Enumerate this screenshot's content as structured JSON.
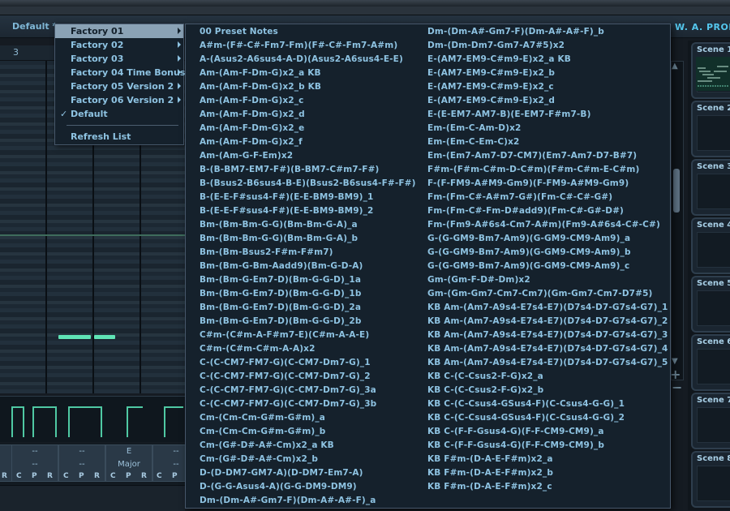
{
  "header": {
    "preset_name": "Default *",
    "brand": "W. A. PRODUCTION"
  },
  "timeline": {
    "bar_number": "3"
  },
  "chord_slots": [
    {
      "line1": "",
      "line2": ""
    },
    {
      "line1": "--",
      "line2": "--"
    },
    {
      "line1": "--",
      "line2": "--"
    },
    {
      "line1": "E",
      "line2": "Major"
    },
    {
      "line1": "--",
      "line2": "--"
    }
  ],
  "slot_letters": [
    "R",
    "C",
    "P",
    "R",
    "C",
    "P",
    "R",
    "C",
    "P",
    "R",
    "C",
    "P",
    "R",
    "C"
  ],
  "scenes": [
    "Scene 1",
    "Scene 2",
    "Scene 3",
    "Scene 4",
    "Scene 5",
    "Scene 6",
    "Scene 7",
    "Scene 8"
  ],
  "menu": {
    "items": [
      {
        "label": "Factory 01",
        "has_submenu": true,
        "highlighted": true
      },
      {
        "label": "Factory 02",
        "has_submenu": true
      },
      {
        "label": "Factory 03",
        "has_submenu": true
      },
      {
        "label": "Factory 04 Time Bonus",
        "has_submenu": true
      },
      {
        "label": "Factory 05 Version 2",
        "has_submenu": true
      },
      {
        "label": "Factory 06 Version 2",
        "has_submenu": true
      },
      {
        "label": "Default",
        "checked": true
      }
    ],
    "check_mark": "✓",
    "refresh_label": "Refresh List"
  },
  "presets": {
    "column1": [
      "00 Preset Notes",
      "A#m-(F#-C#-Fm7-Fm)(F#-C#-Fm7-A#m)",
      "A-(Asus2-A6sus4-A-D)(Asus2-A6sus4-E-E)",
      "Am-(Am-F-Dm-G)x2_a KB",
      "Am-(Am-F-Dm-G)x2_b KB",
      "Am-(Am-F-Dm-G)x2_c",
      "Am-(Am-F-Dm-G)x2_d",
      "Am-(Am-F-Dm-G)x2_e",
      "Am-(Am-F-Dm-G)x2_f",
      "Am-(Am-G-F-Em)x2",
      "B-(B-BM7-EM7-F#)(B-BM7-C#m7-F#)",
      "B-(Bsus2-B6sus4-B-E)(Bsus2-B6sus4-F#-F#)",
      "B-(E-E-F#sus4-F#)(E-E-BM9-BM9)_1",
      "B-(E-E-F#sus4-F#)(E-E-BM9-BM9)_2",
      "Bm-(Bm-Bm-G-G)(Bm-Bm-G-A)_a",
      "Bm-(Bm-Bm-G-G)(Bm-Bm-G-A)_b",
      "Bm-(Bm-Bsus2-F#m-F#m7)",
      "Bm-(Bm-G-Bm-Aadd9)(Bm-G-D-A)",
      "Bm-(Bm-G-Em7-D)(Bm-G-G-D)_1a",
      "Bm-(Bm-G-Em7-D)(Bm-G-G-D)_1b",
      "Bm-(Bm-G-Em7-D)(Bm-G-G-D)_2a",
      "Bm-(Bm-G-Em7-D)(Bm-G-G-D)_2b",
      "C#m-(C#m-A-F#m7-E)(C#m-A-A-E)",
      "C#m-(C#m-C#m-A-A)x2",
      "C-(C-CM7-FM7-G)(C-CM7-Dm7-G)_1",
      "C-(C-CM7-FM7-G)(C-CM7-Dm7-G)_2",
      "C-(C-CM7-FM7-G)(C-CM7-Dm7-G)_3a",
      "C-(C-CM7-FM7-G)(C-CM7-Dm7-G)_3b",
      "Cm-(Cm-Cm-G#m-G#m)_a",
      "Cm-(Cm-Cm-G#m-G#m)_b",
      "Cm-(G#-D#-A#-Cm)x2_a KB",
      "Cm-(G#-D#-A#-Cm)x2_b",
      "D-(D-DM7-GM7-A)(D-DM7-Em7-A)",
      "D-(G-G-Asus4-A)(G-G-DM9-DM9)",
      "Dm-(Dm-A#-Gm7-F)(Dm-A#-A#-F)_a"
    ],
    "column2": [
      "Dm-(Dm-A#-Gm7-F)(Dm-A#-A#-F)_b",
      "Dm-(Dm-Dm7-Gm7-A7#5)x2",
      "E-(AM7-EM9-C#m9-E)x2_a KB",
      "E-(AM7-EM9-C#m9-E)x2_b",
      "E-(AM7-EM9-C#m9-E)x2_c",
      "E-(AM7-EM9-C#m9-E)x2_d",
      "E-(E-EM7-AM7-B)(E-EM7-F#m7-B)",
      "Em-(Em-C-Am-D)x2",
      "Em-(Em-C-Em-C)x2",
      "Em-(Em7-Am7-D7-CM7)(Em7-Am7-D7-B#7)",
      "F#m-(F#m-C#m-D-C#m)(F#m-C#m-E-C#m)",
      "F-(F-FM9-A#M9-Gm9)(F-FM9-A#M9-Gm9)",
      "Fm-(Fm-C#-A#m7-G#)(Fm-C#-C#-G#)",
      "Fm-(Fm-C#-Fm-D#add9)(Fm-C#-G#-D#)",
      "Fm-(Fm9-A#6s4-Cm7-A#m)(Fm9-A#6s4-C#-C#)",
      "G-(G-GM9-Bm7-Am9)(G-GM9-CM9-Am9)_a",
      "G-(G-GM9-Bm7-Am9)(G-GM9-CM9-Am9)_b",
      "G-(G-GM9-Bm7-Am9)(G-GM9-CM9-Am9)_c",
      "Gm-(Gm-F-D#-Dm)x2",
      "Gm-(Gm-Gm7-Cm7-Cm7)(Gm-Gm7-Cm7-D7#5)",
      "KB Am-(Am7-A9s4-E7s4-E7)(D7s4-D7-G7s4-G7)_1",
      "KB Am-(Am7-A9s4-E7s4-E7)(D7s4-D7-G7s4-G7)_2",
      "KB Am-(Am7-A9s4-E7s4-E7)(D7s4-D7-G7s4-G7)_3",
      "KB Am-(Am7-A9s4-E7s4-E7)(D7s4-D7-G7s4-G7)_4",
      "KB Am-(Am7-A9s4-E7s4-E7)(D7s4-D7-G7s4-G7)_5",
      "KB C-(C-Csus2-F-G)x2_a",
      "KB C-(C-Csus2-F-G)x2_b",
      "KB C-(C-Csus4-GSus4-F)(C-Csus4-G-G)_1",
      "KB C-(C-Csus4-GSus4-F)(C-Csus4-G-G)_2",
      "KB C-(F-F-Gsus4-G)(F-F-CM9-CM9)_a",
      "KB C-(F-F-Gsus4-G)(F-F-CM9-CM9)_b",
      "KB F#m-(D-A-E-F#m)x2_a",
      "KB F#m-(D-A-E-F#m)x2_b",
      "KB F#m-(D-A-E-F#m)x2_c"
    ]
  }
}
